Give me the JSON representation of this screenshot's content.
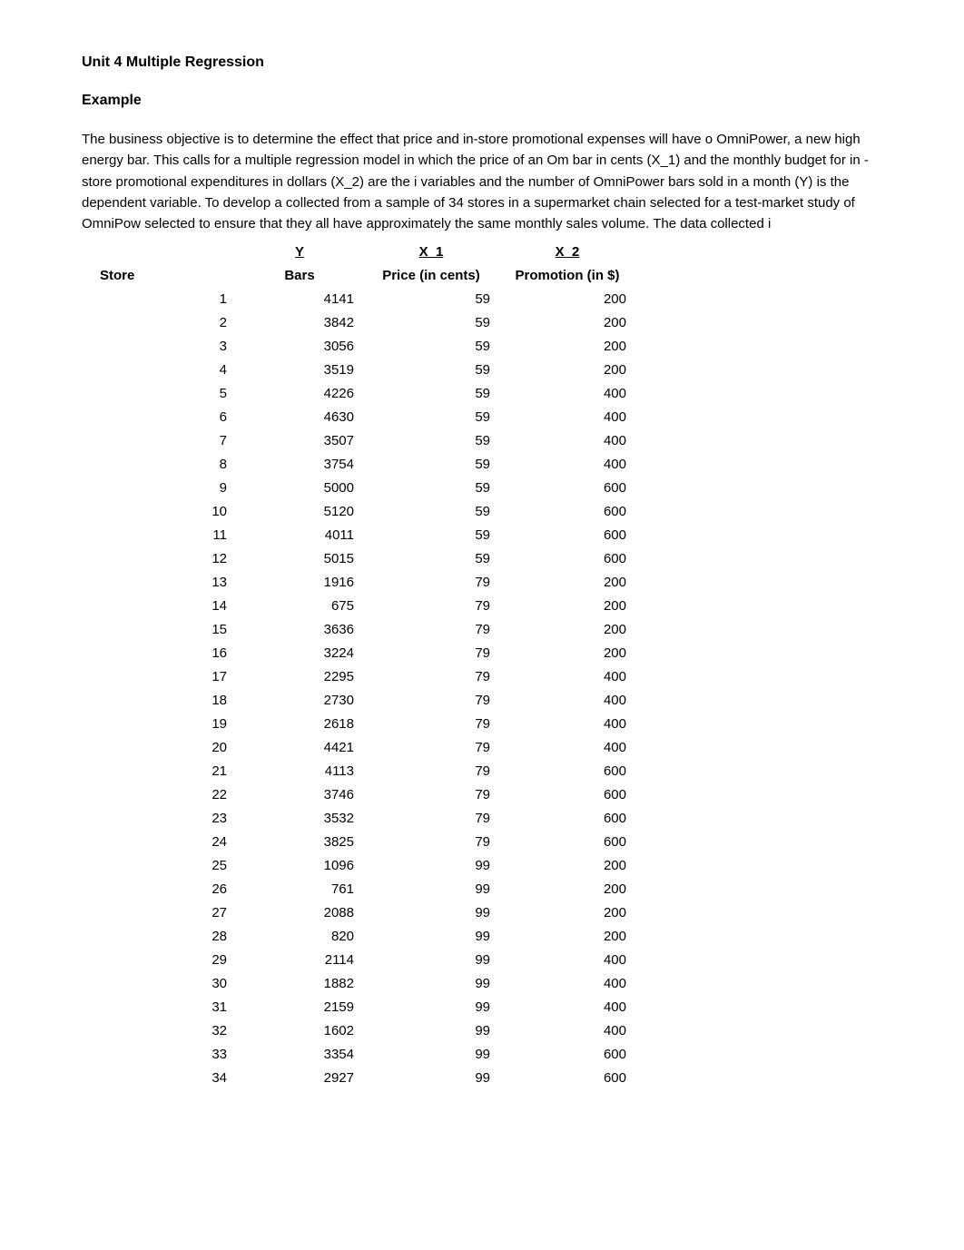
{
  "title": "Unit 4 Multiple Regression",
  "subtitle": "Example",
  "intro": "The business objective is to determine the effect that price and in-store promotional expenses will have o OmniPower, a new high energy bar. This calls for a multiple regression model in which the price of an Om bar in cents (X_1) and the monthly budget for in -store promotional expenditures in dollars (X_2) are the i variables and the number of OmniPower bars sold in a month (Y) is the dependent variable. To develop a collected from a sample of 34 stores in a supermarket chain selected for a test-market study of OmniPow selected to ensure that they all have approximately the same monthly sales volume.  The data collected i",
  "headers": {
    "var_y": "Y",
    "var_x1": "X_1",
    "var_x2": "X_2",
    "store": "Store",
    "bars": "Bars",
    "price": "Price (in cents)",
    "promotion": "Promotion (in $)"
  },
  "chart_data": {
    "type": "table",
    "columns": [
      "Store",
      "Bars",
      "Price (in cents)",
      "Promotion (in $)"
    ],
    "rows": [
      {
        "store": 1,
        "bars": 4141,
        "price": 59,
        "promotion": 200
      },
      {
        "store": 2,
        "bars": 3842,
        "price": 59,
        "promotion": 200
      },
      {
        "store": 3,
        "bars": 3056,
        "price": 59,
        "promotion": 200
      },
      {
        "store": 4,
        "bars": 3519,
        "price": 59,
        "promotion": 200
      },
      {
        "store": 5,
        "bars": 4226,
        "price": 59,
        "promotion": 400
      },
      {
        "store": 6,
        "bars": 4630,
        "price": 59,
        "promotion": 400
      },
      {
        "store": 7,
        "bars": 3507,
        "price": 59,
        "promotion": 400
      },
      {
        "store": 8,
        "bars": 3754,
        "price": 59,
        "promotion": 400
      },
      {
        "store": 9,
        "bars": 5000,
        "price": 59,
        "promotion": 600
      },
      {
        "store": 10,
        "bars": 5120,
        "price": 59,
        "promotion": 600
      },
      {
        "store": 11,
        "bars": 4011,
        "price": 59,
        "promotion": 600
      },
      {
        "store": 12,
        "bars": 5015,
        "price": 59,
        "promotion": 600
      },
      {
        "store": 13,
        "bars": 1916,
        "price": 79,
        "promotion": 200
      },
      {
        "store": 14,
        "bars": 675,
        "price": 79,
        "promotion": 200
      },
      {
        "store": 15,
        "bars": 3636,
        "price": 79,
        "promotion": 200
      },
      {
        "store": 16,
        "bars": 3224,
        "price": 79,
        "promotion": 200
      },
      {
        "store": 17,
        "bars": 2295,
        "price": 79,
        "promotion": 400
      },
      {
        "store": 18,
        "bars": 2730,
        "price": 79,
        "promotion": 400
      },
      {
        "store": 19,
        "bars": 2618,
        "price": 79,
        "promotion": 400
      },
      {
        "store": 20,
        "bars": 4421,
        "price": 79,
        "promotion": 400
      },
      {
        "store": 21,
        "bars": 4113,
        "price": 79,
        "promotion": 600
      },
      {
        "store": 22,
        "bars": 3746,
        "price": 79,
        "promotion": 600
      },
      {
        "store": 23,
        "bars": 3532,
        "price": 79,
        "promotion": 600
      },
      {
        "store": 24,
        "bars": 3825,
        "price": 79,
        "promotion": 600
      },
      {
        "store": 25,
        "bars": 1096,
        "price": 99,
        "promotion": 200
      },
      {
        "store": 26,
        "bars": 761,
        "price": 99,
        "promotion": 200
      },
      {
        "store": 27,
        "bars": 2088,
        "price": 99,
        "promotion": 200
      },
      {
        "store": 28,
        "bars": 820,
        "price": 99,
        "promotion": 200
      },
      {
        "store": 29,
        "bars": 2114,
        "price": 99,
        "promotion": 400
      },
      {
        "store": 30,
        "bars": 1882,
        "price": 99,
        "promotion": 400
      },
      {
        "store": 31,
        "bars": 2159,
        "price": 99,
        "promotion": 400
      },
      {
        "store": 32,
        "bars": 1602,
        "price": 99,
        "promotion": 400
      },
      {
        "store": 33,
        "bars": 3354,
        "price": 99,
        "promotion": 600
      },
      {
        "store": 34,
        "bars": 2927,
        "price": 99,
        "promotion": 600
      }
    ]
  }
}
